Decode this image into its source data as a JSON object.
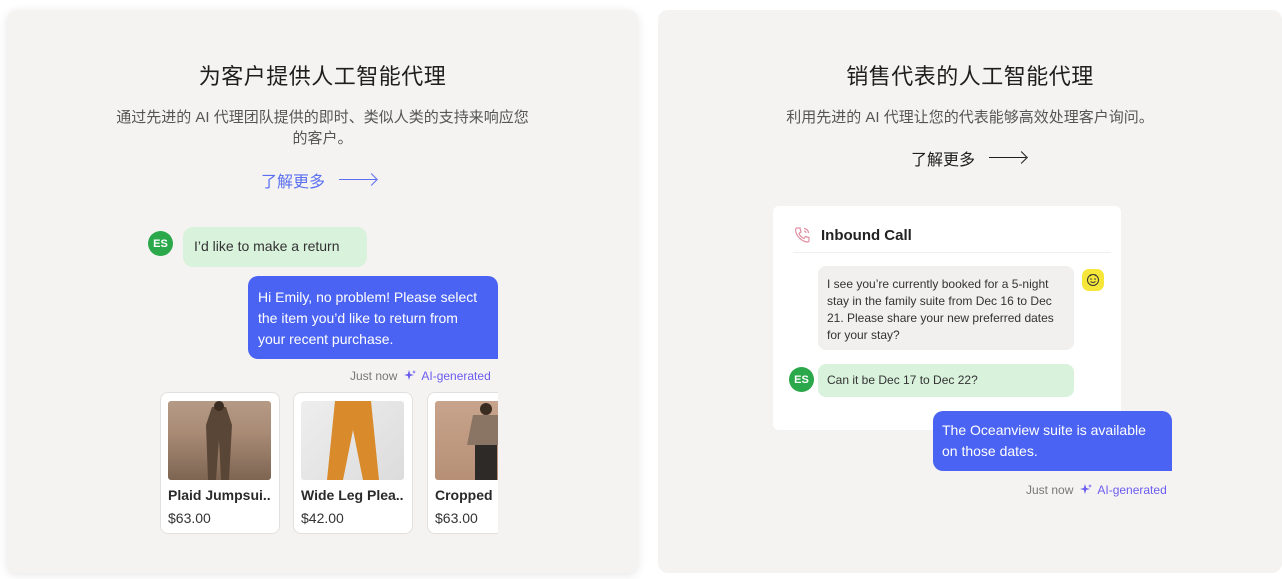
{
  "left_card": {
    "title": "为客户提供人工智能代理",
    "description": "通过先进的 AI 代理团队提供的即时、类似人类的支持来响应您的客户。",
    "learn_more": "了解更多",
    "user_initials": "ES",
    "user_message": "I’d like to make a return",
    "agent_message": "Hi Emily, no problem! Please select the item you’d like to return from your recent purchase.",
    "timestamp": "Just now",
    "ai_label": "AI-generated",
    "products": [
      {
        "name": "Plaid Jumpsui..",
        "price": "$63.00"
      },
      {
        "name": "Wide Leg Plea..",
        "price": "$42.00"
      },
      {
        "name": "Cropped",
        "price": "$63.00"
      }
    ]
  },
  "right_card": {
    "title": "销售代表的人工智能代理",
    "description": "利用先进的 AI 代理让您的代表能够高效处理客户询问。",
    "learn_more": "了解更多",
    "panel_title": "Inbound Call",
    "agent_message": "I see you’re currently booked for a 5-night stay in the family suite from Dec 16 to Dec 21. Please share your new preferred dates for your stay?",
    "user_initials": "ES",
    "user_message": "Can it be Dec 17 to Dec 22?",
    "reply_message": "The Oceanview suite is available on those dates.",
    "timestamp": "Just now",
    "ai_label": "AI-generated"
  },
  "colors": {
    "card_bg": "#f4f3f1",
    "agent_bubble": "#4a63f3",
    "user_bubble": "#d9f2dc",
    "avatar": "#2aa84a",
    "link_blue": "#5b6ff0",
    "ai_purple": "#6b5cf0",
    "bot_yellow": "#f6e63a"
  },
  "icons": [
    "arrow-right-icon",
    "sparkle-icon",
    "phone-icon",
    "bot-face-icon"
  ]
}
